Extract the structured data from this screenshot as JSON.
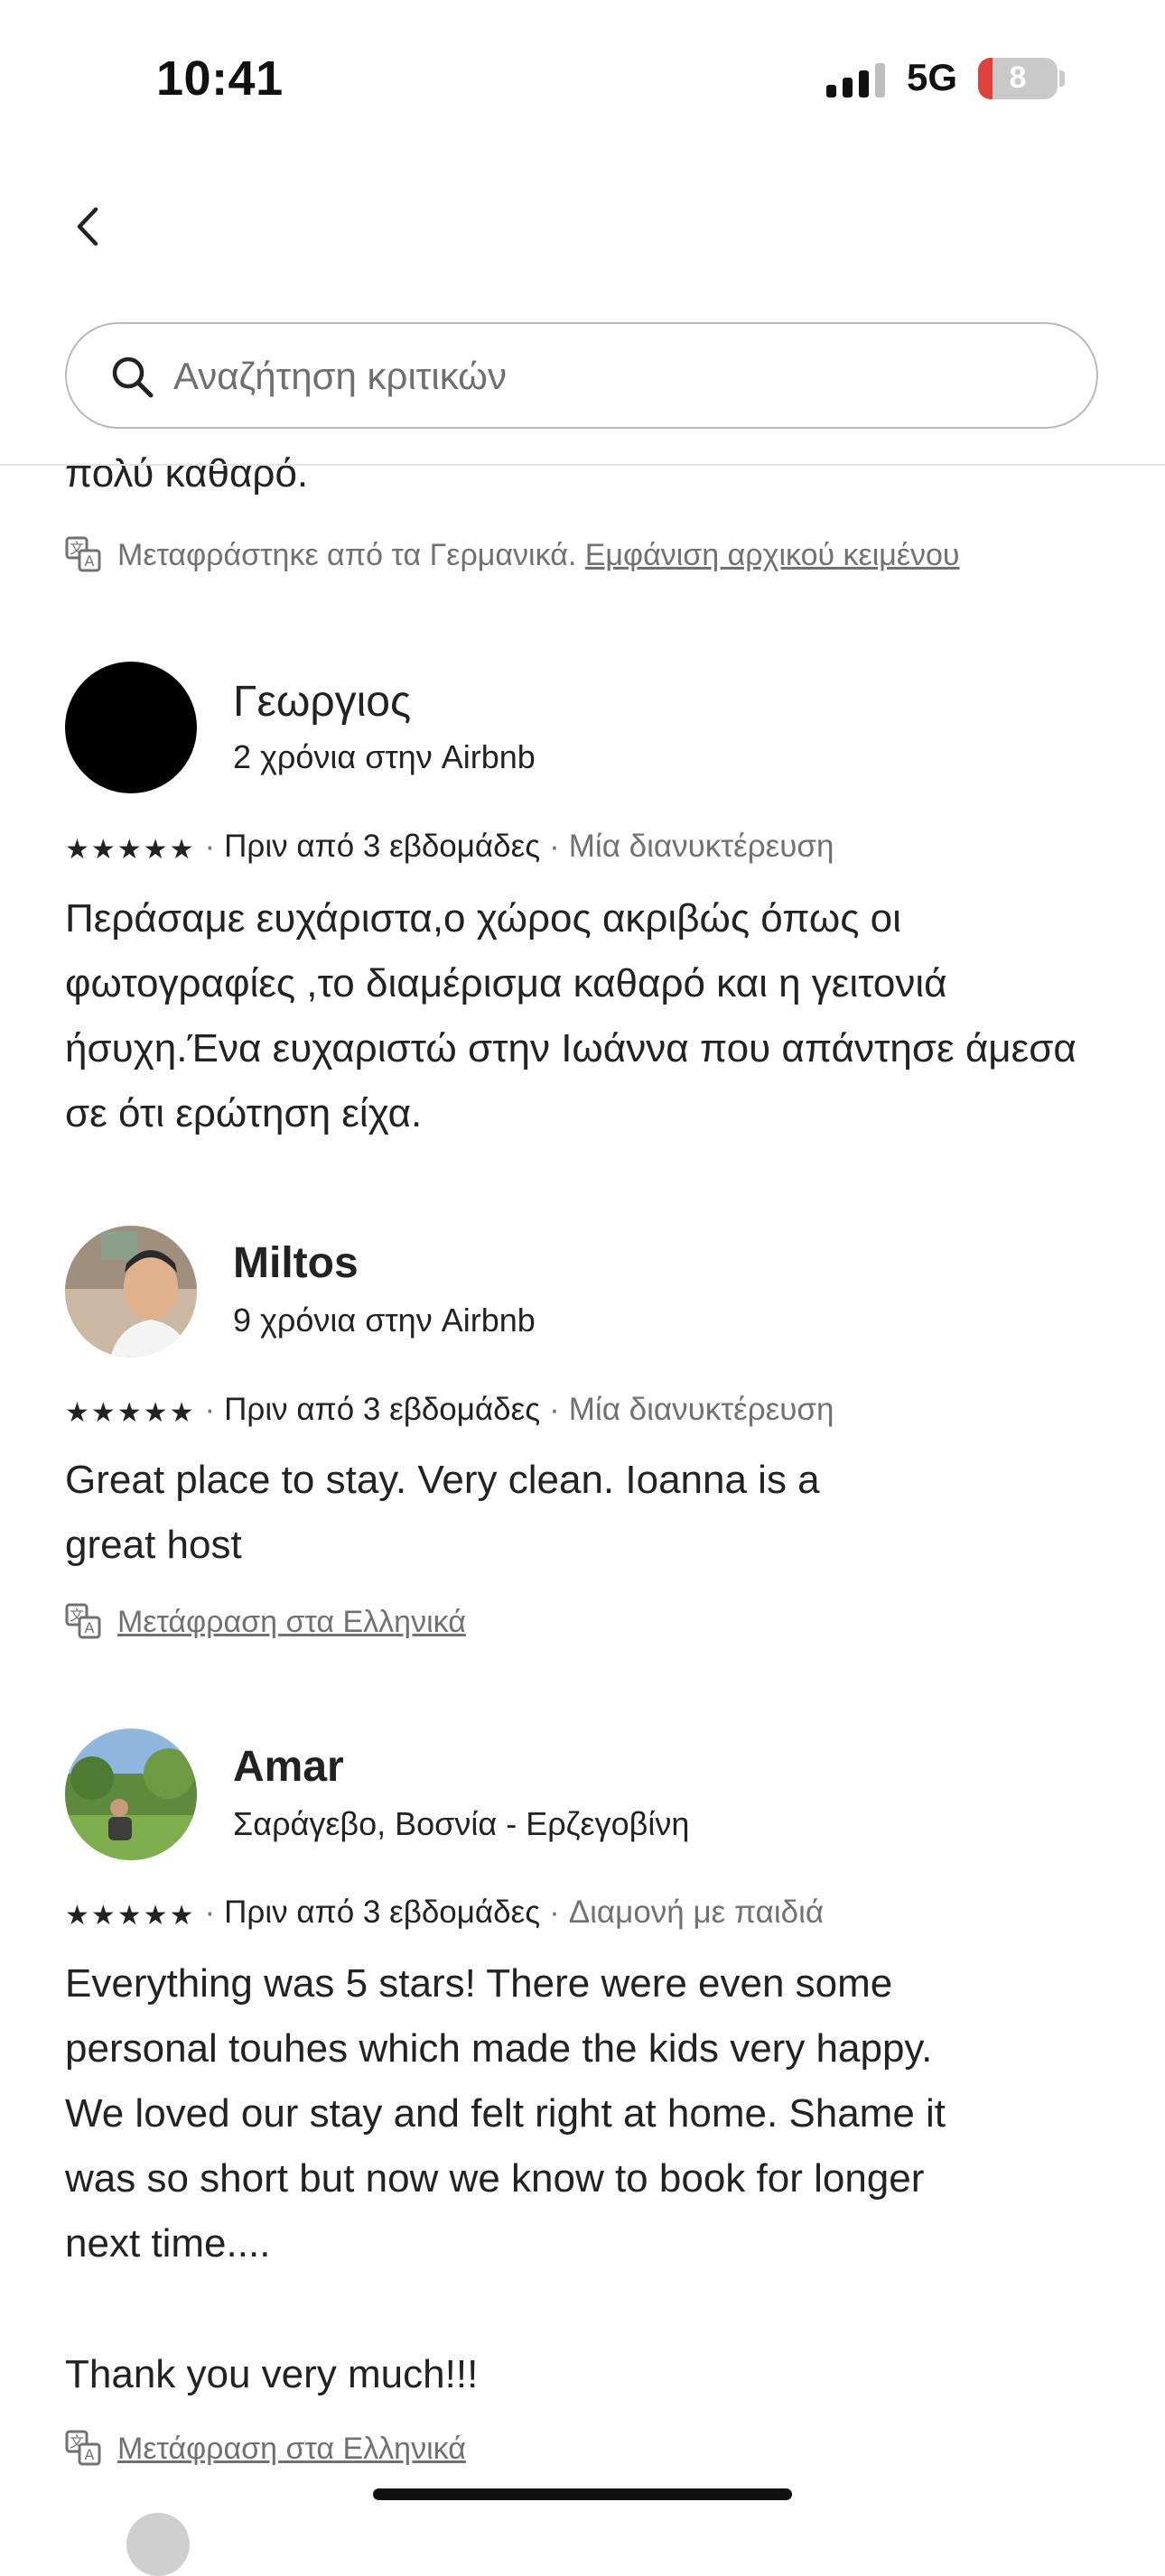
{
  "status_bar": {
    "time": "10:41",
    "network": "5G",
    "battery_level": "8"
  },
  "search": {
    "placeholder": "Αναζήτηση κριτικών"
  },
  "previous_review": {
    "tail_text": "πολύ καθαρό.",
    "translated_note": "Μεταφράστηκε από τα Γερμανικά.",
    "show_original_label": "Εμφάνιση αρχικού κειμένου"
  },
  "reviews": [
    {
      "name": "Γεωργιος",
      "subtitle": "2 χρόνια στην Airbnb",
      "rating": 5,
      "stars": "★★★★★",
      "date": "Πριν από 3 εβδομάδες",
      "trip_type": "Μία διανυκτέρευση",
      "text": "Περάσαμε ευχάριστα,ο χώρος ακριβώς όπως οι φωτογραφίες ,το διαμέρισμα καθαρό και η γειτονιά ήσυχη.Ένα  ευχαριστώ στην Ιωάννα που απάντησε άμεσα σε ότι ερώτηση είχα."
    },
    {
      "name": "Miltos",
      "subtitle": "9 χρόνια στην Airbnb",
      "rating": 5,
      "stars": "★★★★★",
      "date": "Πριν από 3 εβδομάδες",
      "trip_type": "Μία διανυκτέρευση",
      "text_lines": [
        "Great place to stay. Very clean. Ioanna is a",
        "great host"
      ],
      "translate_label": "Μετάφραση στα Ελληνικά"
    },
    {
      "name": "Amar",
      "subtitle": "Σαράγεβο, Βοσνία - Ερζεγοβίνη",
      "rating": 5,
      "stars": "★★★★★",
      "date": "Πριν από 3 εβδομάδες",
      "trip_type": "Διαμονή με παιδιά",
      "text_lines": [
        "Everything was 5 stars! There were even some",
        "personal touhes which made the kids very happy.",
        "We loved our stay and felt right at home. Shame it",
        "was so short but now we know to book for longer",
        "next time...."
      ],
      "text_line_last": "Thank you very much!!!",
      "translate_label": "Μετάφραση στα Ελληνικά"
    }
  ],
  "colors": {
    "text": "#222222",
    "secondary": "#717171",
    "border": "#b9b9b9",
    "battery_low": "#e0413a"
  }
}
